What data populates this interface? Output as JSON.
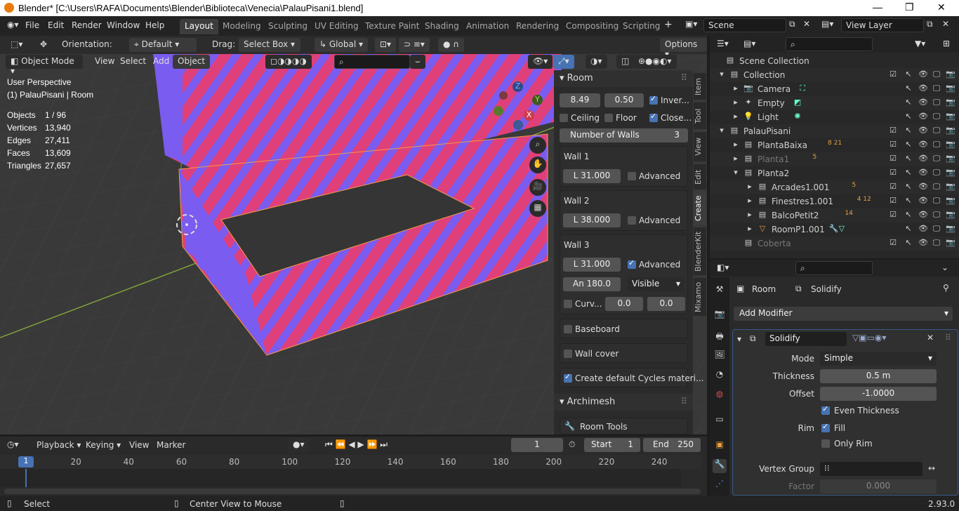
{
  "window": {
    "title": "Blender* [C:\\Users\\RAFA\\Documents\\Blender\\Biblioteca\\Venecia\\PalauPisani1.blend]"
  },
  "menu": [
    "File",
    "Edit",
    "Render",
    "Window",
    "Help"
  ],
  "workspaces": [
    "Layout",
    "Modeling",
    "Sculpting",
    "UV Editing",
    "Texture Paint",
    "Shading",
    "Animation",
    "Rendering",
    "Compositing",
    "Scripting"
  ],
  "scene": {
    "label": "Scene",
    "view_layer": "View Layer"
  },
  "toolbar": {
    "orientation_label": "Orientation:",
    "orientation_value": "Default",
    "drag_label": "Drag:",
    "drag_value": "Select Box",
    "transform_space": "Global",
    "options_label": "Options"
  },
  "viewport_header": {
    "mode": "Object Mode",
    "view": "View",
    "select": "Select",
    "add": "Add",
    "object": "Object"
  },
  "viewport_info": {
    "perspective": "User Perspective",
    "active": "(1) PalauPisani | Room"
  },
  "stats": [
    {
      "label": "Objects",
      "value": "1 / 96"
    },
    {
      "label": "Vertices",
      "value": "13,940"
    },
    {
      "label": "Edges",
      "value": "27,411"
    },
    {
      "label": "Faces",
      "value": "13,609"
    },
    {
      "label": "Triangles",
      "value": "27,657"
    }
  ],
  "gizmo": {
    "z": "Z",
    "y": "Y",
    "x": "X"
  },
  "npanel": {
    "title": "Room",
    "height": "8.49",
    "thickness": "0.50",
    "inverse_label": "Inver...",
    "ceiling_label": "Ceiling",
    "floor_label": "Floor",
    "close_label": "Close...",
    "walls_label": "Number of Walls",
    "walls_count": "3",
    "walls": [
      {
        "title": "Wall 1",
        "length": "L   31.000",
        "advanced": "Advanced"
      },
      {
        "title": "Wall 2",
        "length": "L   38.000",
        "advanced": "Advanced"
      },
      {
        "title": "Wall 3",
        "length": "L   31.000",
        "advanced": "Advanced",
        "angle": "An   180.0",
        "visibility": "Visible",
        "curve_label": "Curv...",
        "curve_a": "0.0",
        "curve_b": "0.0"
      }
    ],
    "baseboard_label": "Baseboard",
    "wall_cover_label": "Wall cover",
    "cycles_label": "Create default Cycles materi...",
    "archimesh_title": "Archimesh",
    "room_tools_label": "Room Tools"
  },
  "sidebar_tabs": [
    "Item",
    "Tool",
    "View",
    "Edit",
    "Create",
    "BlenderKit",
    "Mixamo"
  ],
  "outliner": {
    "root": "Scene Collection",
    "rows": [
      {
        "name": "Collection",
        "badge": ""
      },
      {
        "name": "Camera",
        "badge": ""
      },
      {
        "name": "Empty",
        "badge": ""
      },
      {
        "name": "Light",
        "badge": ""
      },
      {
        "name": "PalauPisani",
        "badge": ""
      },
      {
        "name": "PlantaBaixa",
        "badge": "8  21"
      },
      {
        "name": "Planta1",
        "badge": "5"
      },
      {
        "name": "Planta2",
        "badge": ""
      },
      {
        "name": "Arcades1.001",
        "badge": "5"
      },
      {
        "name": "Finestres1.001",
        "badge": "4  12"
      },
      {
        "name": "BalcoPetit2",
        "badge": "14"
      },
      {
        "name": "RoomP1.001",
        "badge": ""
      },
      {
        "name": "Coberta",
        "badge": ""
      }
    ]
  },
  "properties": {
    "breadcrumb_object": "Room",
    "breadcrumb_modifier": "Solidify",
    "add_modifier": "Add Modifier",
    "modifier_name": "Solidify",
    "mode_label": "Mode",
    "mode_value": "Simple",
    "thickness_label": "Thickness",
    "thickness_value": "0.5 m",
    "offset_label": "Offset",
    "offset_value": "-1.0000",
    "even_thickness": "Even Thickness",
    "rim_label": "Rim",
    "fill_label": "Fill",
    "only_rim": "Only Rim",
    "vertex_group_label": "Vertex Group",
    "factor_label": "Factor",
    "factor_value": "0.000"
  },
  "timeline": {
    "playback": "Playback",
    "keying": "Keying",
    "view": "View",
    "marker": "Marker",
    "current_frame": "1",
    "start_label": "Start",
    "start_value": "1",
    "end_label": "End",
    "end_value": "250",
    "ticks": [
      "20",
      "40",
      "60",
      "80",
      "100",
      "120",
      "140",
      "160",
      "180",
      "200",
      "220",
      "240"
    ],
    "playhead": "1"
  },
  "statusbar": {
    "left": "Select",
    "middle": "Center View to Mouse",
    "version": "2.93.0"
  },
  "colors": {
    "accent": "#4772b3",
    "mesh_pink": "#e0407a",
    "mesh_blue": "#7a5cf0",
    "selection": "#f59b42"
  }
}
